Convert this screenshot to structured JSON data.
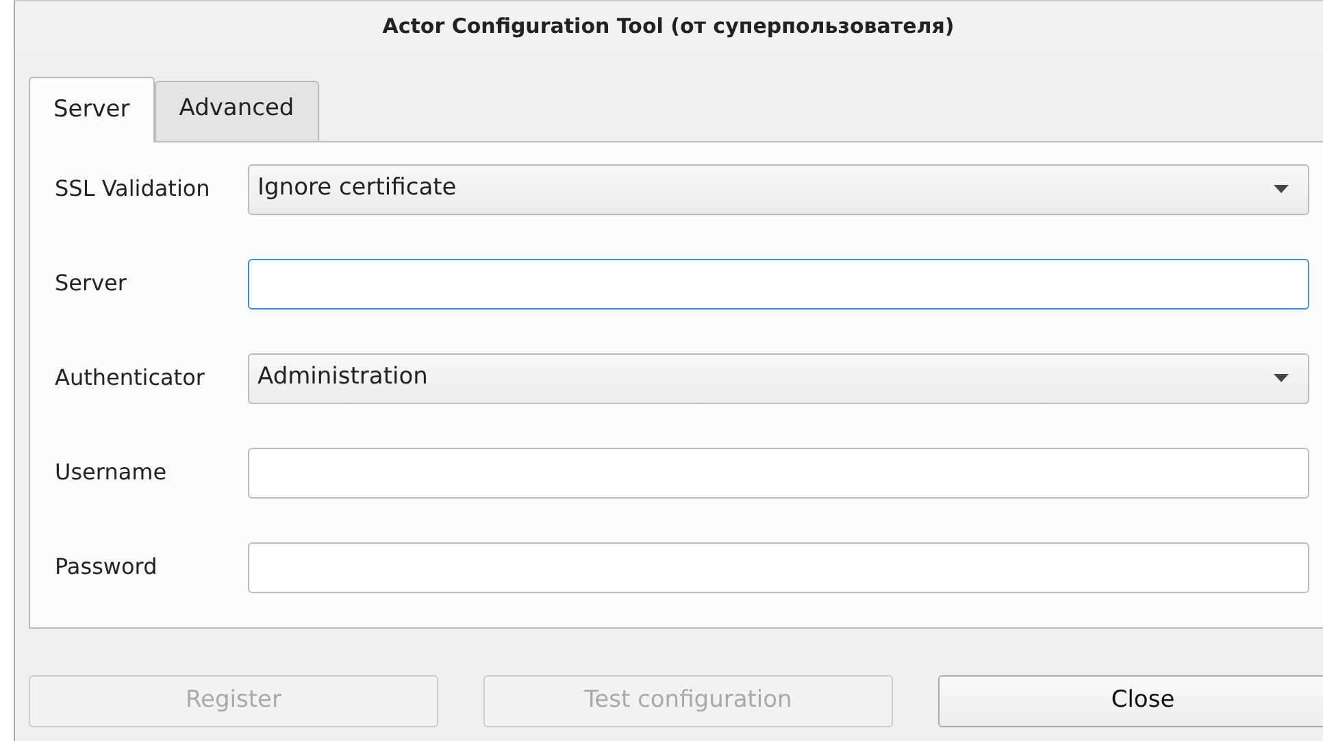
{
  "window": {
    "title": "Actor Configuration Tool (от суперпользователя)"
  },
  "tabs": [
    {
      "label": "Server",
      "selected": true
    },
    {
      "label": "Advanced",
      "selected": false
    }
  ],
  "fields": [
    {
      "kind": "select",
      "label": "SSL Validation",
      "value": "Ignore certificate",
      "focused": false
    },
    {
      "kind": "input",
      "label": "Server",
      "focused": true
    },
    {
      "kind": "select",
      "label": "Authenticator",
      "value": "Administration",
      "focused": false
    },
    {
      "kind": "input",
      "label": "Username",
      "focused": false
    },
    {
      "kind": "input",
      "label": "Password",
      "focused": false
    }
  ],
  "buttons": [
    {
      "label": "Register",
      "disabled": true
    },
    {
      "label": "Test configuration",
      "disabled": true
    },
    {
      "label": "Close",
      "disabled": false
    }
  ]
}
